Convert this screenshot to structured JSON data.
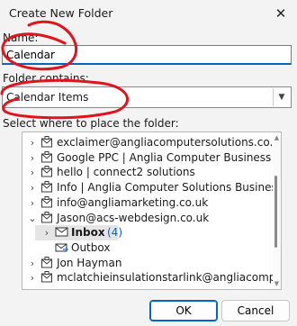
{
  "window": {
    "title": "Create New Folder"
  },
  "form": {
    "name_label": "Name:",
    "name_value": "Calendar",
    "contains_label": "Folder contains:",
    "contains_value": "Calendar Items",
    "place_label": "Select where to place the folder:"
  },
  "tree": {
    "items": [
      {
        "label": "exclaimer@angliacomputersolutions.co.uk",
        "expander": "collapsed",
        "icon": "mailbox-icon"
      },
      {
        "label": "Google PPC | Anglia Computer Business Ltd",
        "expander": "collapsed",
        "icon": "mailbox-icon"
      },
      {
        "label": "hello | connect2 solutions",
        "expander": "collapsed",
        "icon": "mailbox-icon"
      },
      {
        "label": "Info | Anglia Computer Solutions Business",
        "expander": "collapsed",
        "icon": "mailbox-icon"
      },
      {
        "label": "info@angliamarketing.co.uk",
        "expander": "collapsed",
        "icon": "mailbox-icon"
      },
      {
        "label": "Jason@acs-webdesign.co.uk",
        "expander": "expanded",
        "icon": "mailbox-icon"
      },
      {
        "label": "Inbox",
        "count": "(4)",
        "expander": "collapsed",
        "icon": "inbox-icon",
        "selected": true
      },
      {
        "label": "Outbox",
        "expander": "none",
        "icon": "outbox-icon"
      },
      {
        "label": "Jon Hayman",
        "expander": "collapsed",
        "icon": "mailbox-icon"
      },
      {
        "label": "mclatchieinsulationstarlink@angliacomputerso",
        "expander": "collapsed",
        "icon": "mailbox-icon"
      }
    ]
  },
  "buttons": {
    "ok": "OK",
    "cancel": "Cancel"
  },
  "colors": {
    "accent": "#0067c0",
    "annotation": "#e0141e",
    "unread_count": "#0f5fbf"
  }
}
